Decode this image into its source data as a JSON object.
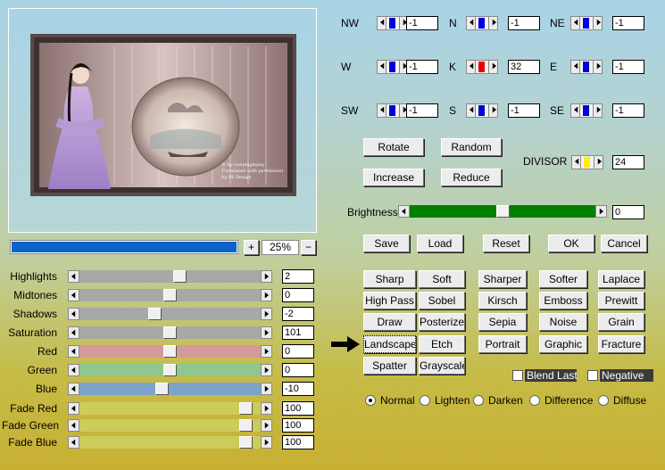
{
  "preview": {
    "caption_lines": [
      "© by cunpingtopsy",
      "Translated with permission",
      "by SS Design"
    ]
  },
  "zoom": {
    "progress_fraction": 1.0,
    "plus": "+",
    "value": "25%",
    "minus": "−"
  },
  "sliders": [
    {
      "label": "Highlights",
      "value": "2",
      "track": "#a8a8a8",
      "pos": 0.56
    },
    {
      "label": "Midtones",
      "value": "0",
      "track": "#a8a8a8",
      "pos": 0.5
    },
    {
      "label": "Shadows",
      "value": "-2",
      "track": "#a8a8a8",
      "pos": 0.41
    },
    {
      "label": "Saturation",
      "value": "101",
      "track": "#a8a8a8",
      "pos": 0.5
    },
    {
      "label": "Red",
      "value": "0",
      "track": "#d69a9a",
      "pos": 0.5
    },
    {
      "label": "Green",
      "value": "0",
      "track": "#8ec88e",
      "pos": 0.5
    },
    {
      "label": "Blue",
      "value": "-10",
      "track": "#7ca4c8",
      "pos": 0.45
    },
    {
      "label": "Fade Red",
      "value": "100",
      "track": "#cccc5a",
      "pos": 0.95
    },
    {
      "label": "Fade Green",
      "value": "100",
      "track": "#cccc5a",
      "pos": 0.95
    },
    {
      "label": "Fade Blue",
      "value": "100",
      "track": "#cccc5a",
      "pos": 0.95
    }
  ],
  "kernel": [
    {
      "label": "NW",
      "value": "-1",
      "color": "#0000dd"
    },
    {
      "label": "N",
      "value": "-1",
      "color": "#0000dd"
    },
    {
      "label": "NE",
      "value": "-1",
      "color": "#0000dd"
    },
    {
      "label": "W",
      "value": "-1",
      "color": "#0000dd"
    },
    {
      "label": "K",
      "value": "32",
      "color": "#ee0000"
    },
    {
      "label": "E",
      "value": "-1",
      "color": "#0000dd"
    },
    {
      "label": "SW",
      "value": "-1",
      "color": "#0000dd"
    },
    {
      "label": "S",
      "value": "-1",
      "color": "#0000dd"
    },
    {
      "label": "SE",
      "value": "-1",
      "color": "#0000dd"
    }
  ],
  "actions": {
    "rotate": "Rotate",
    "random": "Random",
    "increase": "Increase",
    "reduce": "Reduce"
  },
  "divisor": {
    "label": "DIVISOR",
    "value": "24",
    "color": "#ffee00"
  },
  "brightness": {
    "label": "Brightness",
    "value": "0",
    "color": "#008000",
    "pos": 0.5
  },
  "dialog_buttons": {
    "save": "Save",
    "load": "Load",
    "reset": "Reset",
    "ok": "OK",
    "cancel": "Cancel"
  },
  "presets": [
    "Sharp",
    "Soft",
    "Sharper",
    "Softer",
    "Laplace",
    "High Pass",
    "Sobel",
    "Kirsch",
    "Emboss",
    "Prewitt",
    "Draw",
    "Posterize",
    "Sepia",
    "Noise",
    "Grain",
    "Landscape",
    "Etch",
    "Portrait",
    "Graphic",
    "Fracture",
    "Spatter",
    "Grayscale"
  ],
  "selected_preset": "Landscape",
  "options": {
    "blend_last": "Blend Last",
    "negative": "Negative"
  },
  "blend_modes": [
    "Normal",
    "Lighten",
    "Darken",
    "Difference",
    "Diffuse"
  ],
  "selected_mode": "Normal"
}
